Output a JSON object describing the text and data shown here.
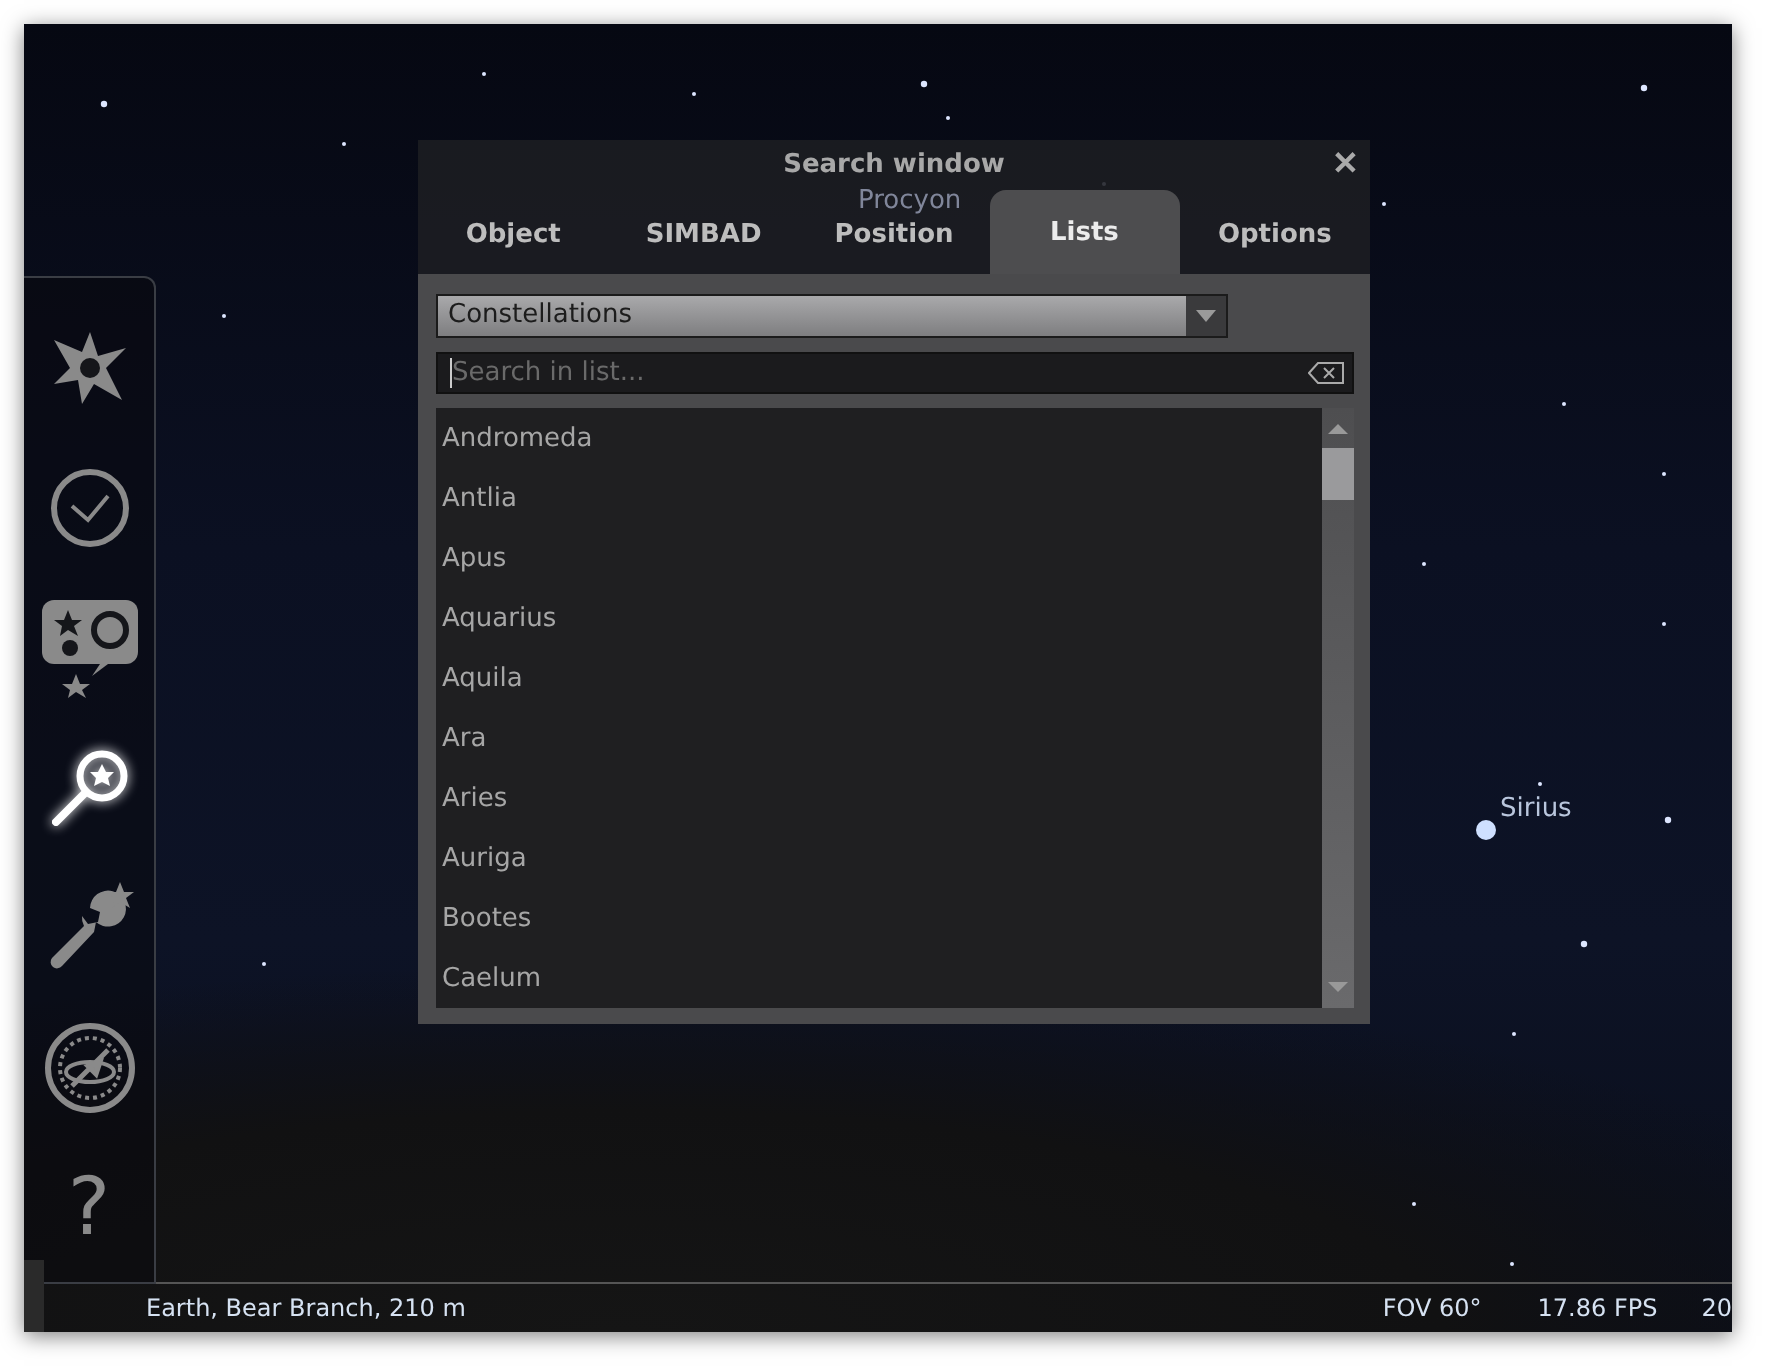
{
  "sky_labels": [
    {
      "kind": "faint",
      "text": "Procyon"
    },
    {
      "kind": "bright",
      "text": "Sirius"
    }
  ],
  "sidebar": {
    "items": [
      {
        "kind": "sky",
        "selected": false
      },
      {
        "kind": "time",
        "selected": false
      },
      {
        "kind": "objects",
        "selected": false
      },
      {
        "kind": "search",
        "selected": true
      },
      {
        "kind": "settings",
        "selected": false
      },
      {
        "kind": "astrocalc",
        "selected": false
      },
      {
        "kind": "help",
        "selected": false,
        "glyph": "?"
      }
    ]
  },
  "dialog": {
    "title": "Search window",
    "close": "✕",
    "tabs": [
      {
        "label": "Object",
        "selected": false
      },
      {
        "label": "SIMBAD",
        "selected": false
      },
      {
        "label": "Position",
        "selected": false
      },
      {
        "label": "Lists",
        "selected": true
      },
      {
        "label": "Options",
        "selected": false
      }
    ],
    "list_type": {
      "value": "Constellations"
    },
    "search": {
      "placeholder": "Search in list..."
    },
    "items": [
      "Andromeda",
      "Antlia",
      "Apus",
      "Aquarius",
      "Aquila",
      "Ara",
      "Aries",
      "Auriga",
      "Bootes",
      "Caelum"
    ]
  },
  "status_bar": {
    "location": "Earth, Bear Branch, 210 m",
    "fov": "FOV 60°",
    "fps": "17.86 FPS",
    "date": "20"
  }
}
